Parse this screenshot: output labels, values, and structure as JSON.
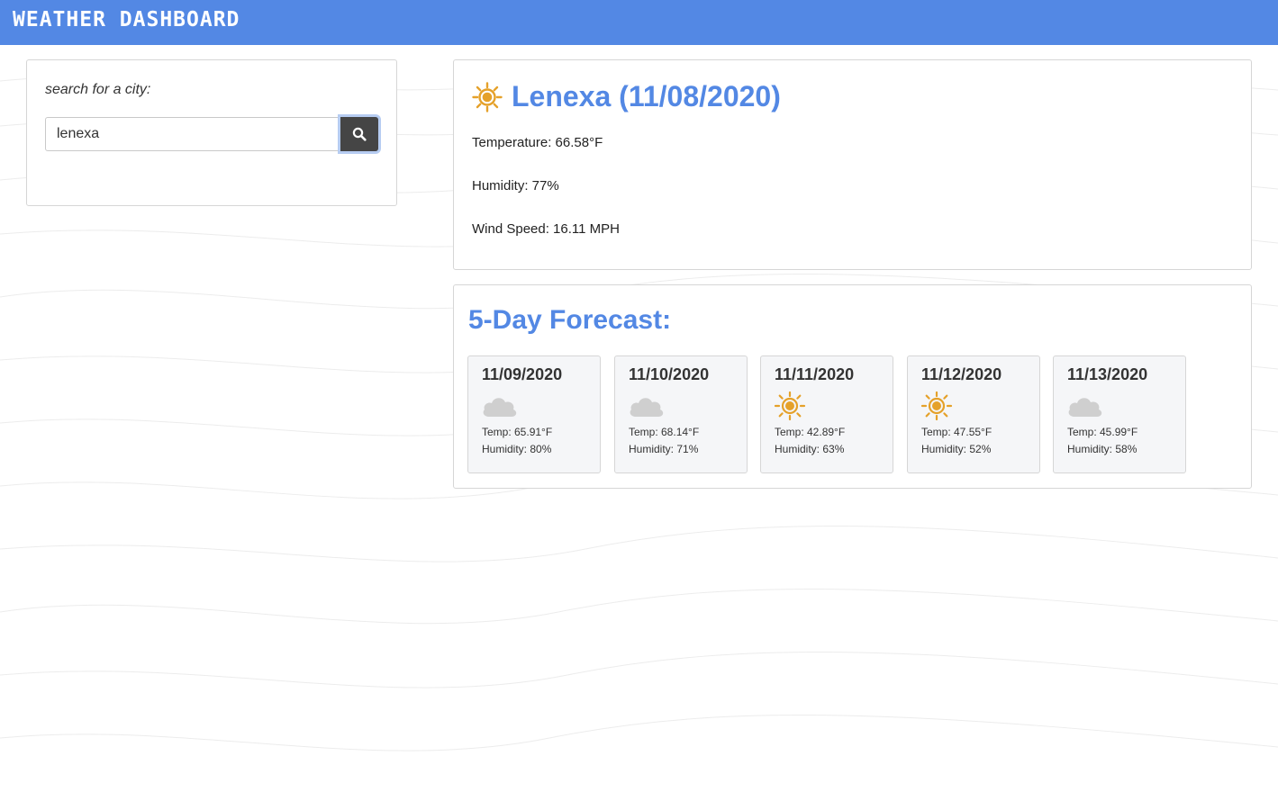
{
  "header": {
    "title": "WEATHER DASHBOARD"
  },
  "search": {
    "label": "search for a city:",
    "value": "lenexa",
    "button_icon": "search-icon"
  },
  "current": {
    "icon": "sun-icon",
    "title": "Lenexa (11/08/2020)",
    "temperature": "Temperature: 66.58°F",
    "humidity": "Humidity: 77%",
    "wind": "Wind Speed: 16.11 MPH"
  },
  "forecast": {
    "title": "5-Day Forecast:",
    "days": [
      {
        "date": "11/09/2020",
        "icon": "cloud-icon",
        "temp": "Temp: 65.91°F",
        "humidity": "Humidity: 80%"
      },
      {
        "date": "11/10/2020",
        "icon": "cloud-icon",
        "temp": "Temp: 68.14°F",
        "humidity": "Humidity: 71%"
      },
      {
        "date": "11/11/2020",
        "icon": "sun-icon",
        "temp": "Temp: 42.89°F",
        "humidity": "Humidity: 63%"
      },
      {
        "date": "11/12/2020",
        "icon": "sun-icon",
        "temp": "Temp: 47.55°F",
        "humidity": "Humidity: 52%"
      },
      {
        "date": "11/13/2020",
        "icon": "cloud-icon",
        "temp": "Temp: 45.99°F",
        "humidity": "Humidity: 58%"
      }
    ]
  },
  "colors": {
    "header_bg": "#5388e4",
    "accent": "#5388e4",
    "sun": "#e5a12a",
    "cloud": "#cfcfcf",
    "search_button": "#454545"
  }
}
